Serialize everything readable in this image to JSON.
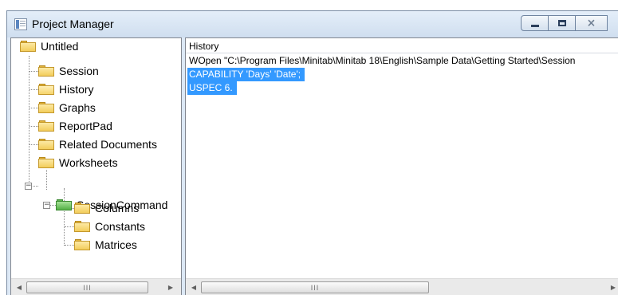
{
  "window": {
    "title": "Project Manager",
    "icon": "project-manager-icon",
    "controls": [
      "minimize-icon",
      "maximize-icon",
      "close-icon"
    ],
    "close_glyph": "⨯"
  },
  "tree": {
    "items": [
      {
        "label": "Untitled",
        "icon": "folder-icon"
      },
      {
        "label": "Session",
        "icon": "folder-icon"
      },
      {
        "label": "History",
        "icon": "folder-open-icon"
      },
      {
        "label": "Graphs",
        "icon": "folder-icon"
      },
      {
        "label": "ReportPad",
        "icon": "folder-icon"
      },
      {
        "label": "Related Documents",
        "icon": "folder-icon"
      },
      {
        "label": "Worksheets",
        "icon": "folder-icon",
        "expander": "−"
      },
      {
        "label": "SessionCommand",
        "icon": "worksheet-folder-icon",
        "expander": "−"
      },
      {
        "label": "Columns",
        "icon": "folder-icon"
      },
      {
        "label": "Constants",
        "icon": "folder-icon"
      },
      {
        "label": "Matrices",
        "icon": "folder-icon"
      }
    ]
  },
  "history": {
    "header": "History",
    "lines": [
      "WOpen \"C:\\Program Files\\Minitab\\Minitab 18\\English\\Sample Data\\Getting Started\\Session",
      "CAPABILITY 'Days' 'Date';",
      "USPEC 6."
    ],
    "selected": [
      1,
      2
    ]
  },
  "scrollbars": {
    "left_arrow": "◀",
    "right_arrow": "▶",
    "thumb_grip": "III"
  },
  "colors": {
    "selection": "#3399ff",
    "window_frame": "#dce8f5"
  }
}
